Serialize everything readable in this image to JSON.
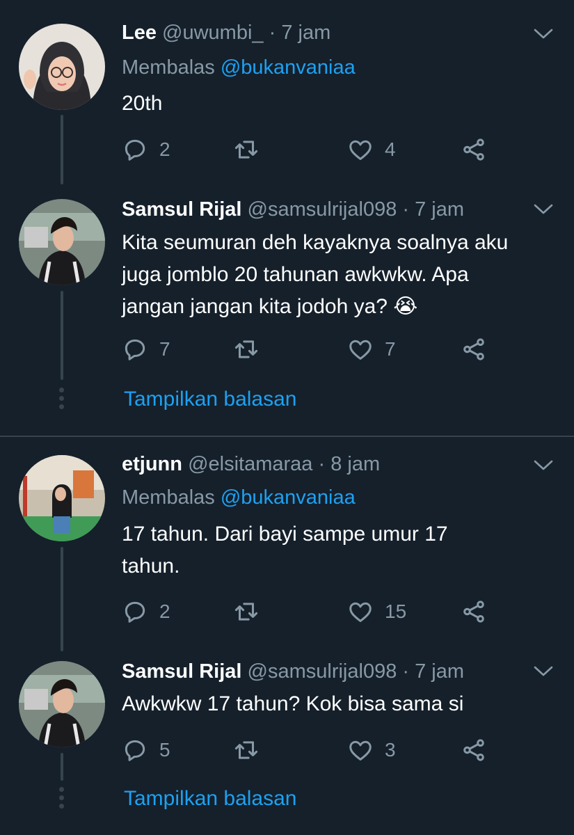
{
  "threads": [
    {
      "tweets": [
        {
          "name": "Lee",
          "handle": "@uwumbi_",
          "sep": "·",
          "time": "7 jam",
          "reply_prefix": "Membalas",
          "reply_to": "@bukanvaniaa",
          "text": "20th",
          "replies": "2",
          "retweets": "",
          "likes": "4"
        },
        {
          "name": "Samsul Rijal",
          "handle": "@samsulrijal098",
          "sep": "·",
          "time": "7 jam",
          "text": "Kita seumuran deh kayaknya soalnya aku juga jomblo 20 tahunan awkwkw. Apa jangan jangan kita jodoh ya? 😭",
          "replies": "7",
          "retweets": "",
          "likes": "7"
        }
      ],
      "show_replies": "Tampilkan balasan"
    },
    {
      "tweets": [
        {
          "name": "etjunn",
          "handle": "@elsitamaraa",
          "sep": "·",
          "time": "8 jam",
          "reply_prefix": "Membalas",
          "reply_to": "@bukanvaniaa",
          "text": "17 tahun. Dari bayi sampe umur 17 tahun.",
          "replies": "2",
          "retweets": "",
          "likes": "15"
        },
        {
          "name": "Samsul Rijal",
          "handle": "@samsulrijal098",
          "sep": "·",
          "time": "7 jam",
          "text": "Awkwkw 17 tahun? Kok bisa sama si",
          "replies": "5",
          "retweets": "",
          "likes": "3"
        }
      ],
      "show_replies": "Tampilkan balasan"
    }
  ],
  "icons": {
    "reply": "reply-icon",
    "retweet": "retweet-icon",
    "like": "heart-icon",
    "share": "share-icon",
    "menu": "chevron-down-icon"
  },
  "colors": {
    "background": "#15202b",
    "muted": "#8899a6",
    "accent": "#1da1f2",
    "line": "#38444d"
  }
}
